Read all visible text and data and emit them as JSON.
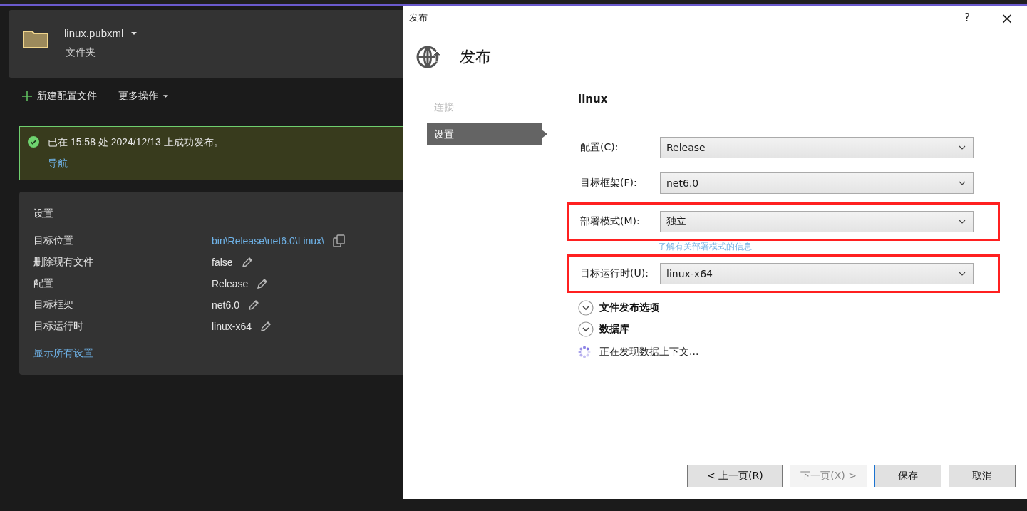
{
  "profile": {
    "name": "linux.pubxml",
    "subtitle": "文件夹"
  },
  "toolbar": [
    {
      "kind": "add",
      "label": "新建配置文件"
    },
    {
      "kind": "menu",
      "label": "更多操作"
    }
  ],
  "banner": {
    "message": "已在 15:58 处 2024/12/13 上成功发布。",
    "link": "导航"
  },
  "settings": {
    "title": "设置",
    "rows": [
      {
        "label": "目标位置",
        "value": "bin\\Release\\net6.0\\Linux\\",
        "kind": "link"
      },
      {
        "label": "删除现有文件",
        "value": "false",
        "kind": "edit"
      },
      {
        "label": "配置",
        "value": "Release",
        "kind": "edit"
      },
      {
        "label": "目标框架",
        "value": "net6.0",
        "kind": "edit"
      },
      {
        "label": "目标运行时",
        "value": "linux-x64",
        "kind": "edit"
      }
    ],
    "show_all": "显示所有设置"
  },
  "dialog": {
    "title": "发布",
    "help": "?",
    "close": "×",
    "heading": "发布",
    "nav": [
      {
        "label": "连接",
        "selected": false
      },
      {
        "label": "设置",
        "selected": true
      }
    ],
    "profile_name": "linux",
    "fields": [
      {
        "label": "配置(C):",
        "value": "Release",
        "highlighted": false
      },
      {
        "label": "目标框架(F):",
        "value": "net6.0",
        "highlighted": false
      },
      {
        "label": "部署模式(M):",
        "value": "独立",
        "highlighted": true,
        "link": "了解有关部署模式的信息"
      },
      {
        "label": "目标运行时(U):",
        "value": "linux-x64",
        "highlighted": true
      }
    ],
    "sections": [
      {
        "label": "文件发布选项",
        "expanded": false
      },
      {
        "label": "数据库",
        "expanded": false
      }
    ],
    "status": "正在发现数据上下文...",
    "buttons": [
      {
        "label": "< 上一页(R)",
        "kind": "normal",
        "disabled": false
      },
      {
        "label": "下一页(X) >",
        "kind": "normal",
        "disabled": true
      },
      {
        "label": "保存",
        "kind": "default",
        "disabled": false
      },
      {
        "label": "取消",
        "kind": "normal",
        "disabled": false
      }
    ]
  }
}
